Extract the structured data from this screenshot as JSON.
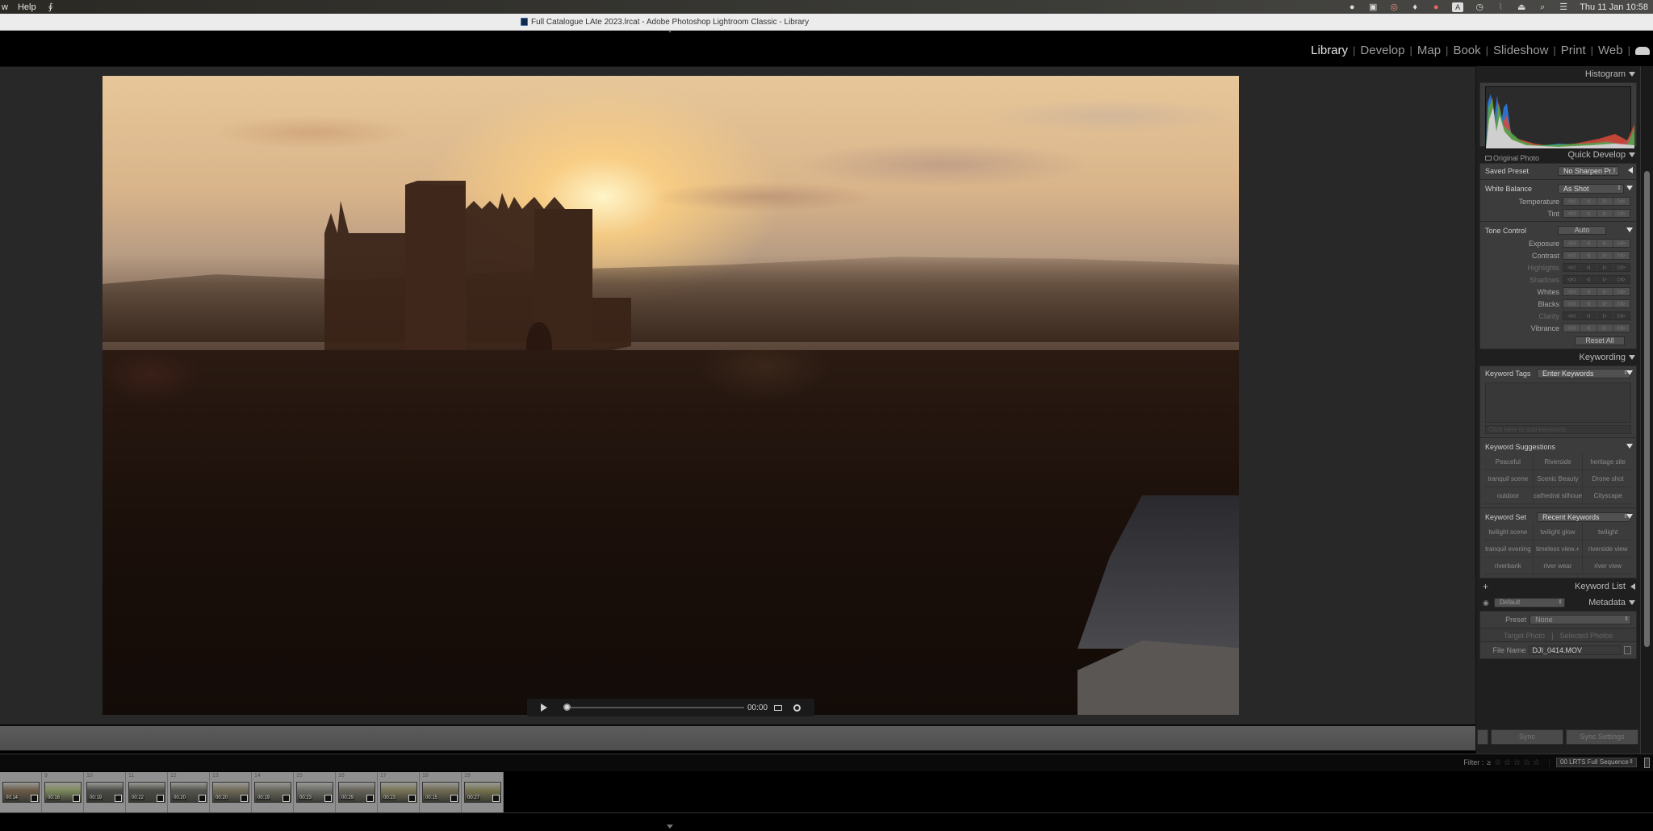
{
  "menubar": {
    "items": [
      "w",
      "Help"
    ],
    "status_icons": [
      "app-icon-1",
      "clipboard-icon",
      "creative-cloud-icon",
      "dropbox-icon",
      "s-app-icon",
      "keyboard-input-icon",
      "time-machine-icon",
      "wifi-off-icon",
      "eject-icon",
      "spotlight-search-icon",
      "control-center-icon"
    ],
    "keyboard_input": "A",
    "clock": "Thu 11 Jan  10:58"
  },
  "window": {
    "title": "Full Catalogue LAte 2023.lrcat - Adobe Photoshop Lightroom Classic - Library"
  },
  "modules": {
    "items": [
      "Library",
      "Develop",
      "Map",
      "Book",
      "Slideshow",
      "Print",
      "Web"
    ],
    "active": "Library"
  },
  "video": {
    "time": "00:00",
    "progress": 0
  },
  "right_panel": {
    "histogram": {
      "title": "Histogram",
      "original_photo_label": "Original Photo"
    },
    "quick_develop": {
      "title": "Quick Develop",
      "saved_preset_label": "Saved Preset",
      "saved_preset_value": "No Sharpen Pr...",
      "white_balance_label": "White Balance",
      "white_balance_value": "As Shot",
      "wb_adjustments": [
        "Temperature",
        "Tint"
      ],
      "tone_control_label": "Tone Control",
      "auto_label": "Auto",
      "tone_adjustments": [
        {
          "label": "Exposure",
          "enabled": true
        },
        {
          "label": "Contrast",
          "enabled": true
        },
        {
          "label": "Highlights",
          "enabled": false
        },
        {
          "label": "Shadows",
          "enabled": false
        },
        {
          "label": "Whites",
          "enabled": true
        },
        {
          "label": "Blacks",
          "enabled": true
        },
        {
          "label": "Clarity",
          "enabled": false
        },
        {
          "label": "Vibrance",
          "enabled": true
        }
      ],
      "stepper_glyphs": [
        "◁◁",
        "◁",
        "▷",
        "▷▷"
      ],
      "reset_all_label": "Reset All"
    },
    "keywording": {
      "title": "Keywording",
      "keyword_tags_label": "Keyword Tags",
      "keyword_tags_value": "Enter Keywords",
      "click_to_add": "Click here to add keywords",
      "suggestions_label": "Keyword Suggestions",
      "suggestions": [
        "Peaceful",
        "Riverside",
        "heritage site",
        "tranquil scene",
        "Scenic Beauty",
        "Drone shot",
        "outdoor",
        "cathedral silhouette",
        "Cityscape"
      ],
      "keyword_set_label": "Keyword Set",
      "keyword_set_value": "Recent Keywords",
      "keyword_set_items": [
        "twilight scene",
        "twilight glow",
        "twilight",
        "tranquil evening",
        "timeless view.+",
        "riverside view",
        "riverbank",
        "river wear",
        "river view"
      ]
    },
    "keyword_list": {
      "title": "Keyword List",
      "add_label": "+"
    },
    "metadata": {
      "title": "Metadata",
      "view_value": "Default",
      "preset_label": "Preset",
      "preset_value": "None",
      "target_photo_label": "Target Photo",
      "selected_photos_label": "Selected Photos",
      "file_name_label": "File Name",
      "file_name_value": "DJI_0414.MOV"
    },
    "sync_label": "Sync",
    "sync_settings_label": "Sync Settings"
  },
  "filter_bar": {
    "filter_label": "Filter :",
    "rating_op": "≥",
    "stars": "☆☆☆☆☆",
    "collection_value": "00 LRTS Full Sequence"
  },
  "filmstrip": {
    "items": [
      {
        "num": "",
        "duration": "00:14",
        "color": "#6a5a48"
      },
      {
        "num": "9",
        "duration": "00:16",
        "color": "#7e8a5c"
      },
      {
        "num": "10",
        "duration": "00:19",
        "color": "#4a4a46"
      },
      {
        "num": "11",
        "duration": "00:22",
        "color": "#4a4c44"
      },
      {
        "num": "12",
        "duration": "00:20",
        "color": "#55554f"
      },
      {
        "num": "13",
        "duration": "00:20",
        "color": "#6f6a58"
      },
      {
        "num": "14",
        "duration": "00:19",
        "color": "#66665c"
      },
      {
        "num": "15",
        "duration": "00:23",
        "color": "#6a6c64"
      },
      {
        "num": "16",
        "duration": "00:29",
        "color": "#66625a"
      },
      {
        "num": "17",
        "duration": "00:23",
        "color": "#787456"
      },
      {
        "num": "18",
        "duration": "00:15",
        "color": "#6e6a52"
      },
      {
        "num": "19",
        "duration": "00:27",
        "color": "#74724e"
      }
    ]
  }
}
